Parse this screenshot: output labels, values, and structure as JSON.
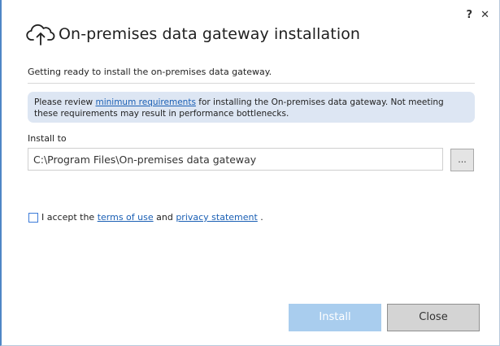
{
  "window": {
    "help_label": "?",
    "close_label": "✕"
  },
  "header": {
    "icon": "cloud-upload-icon",
    "title": "On-premises data gateway installation"
  },
  "subtitle": "Getting ready to install the on-premises data gateway.",
  "info": {
    "prefix": "Please review ",
    "link_text": "minimum requirements",
    "suffix": " for installing the On-premises data gateway. Not meeting these requirements may result in performance bottlenecks."
  },
  "install": {
    "label": "Install to",
    "path": "C:\\Program Files\\On-premises data gateway",
    "browse_label": "..."
  },
  "terms": {
    "checked": false,
    "prefix": "I accept the ",
    "terms_link": "terms of use",
    "middle": " and ",
    "privacy_link": "privacy statement",
    "suffix": " ."
  },
  "buttons": {
    "install_label": "Install",
    "close_label": "Close"
  },
  "colors": {
    "accent": "#1a5fb4",
    "info_bg": "#dde6f3",
    "install_disabled": "#a9cdee"
  }
}
